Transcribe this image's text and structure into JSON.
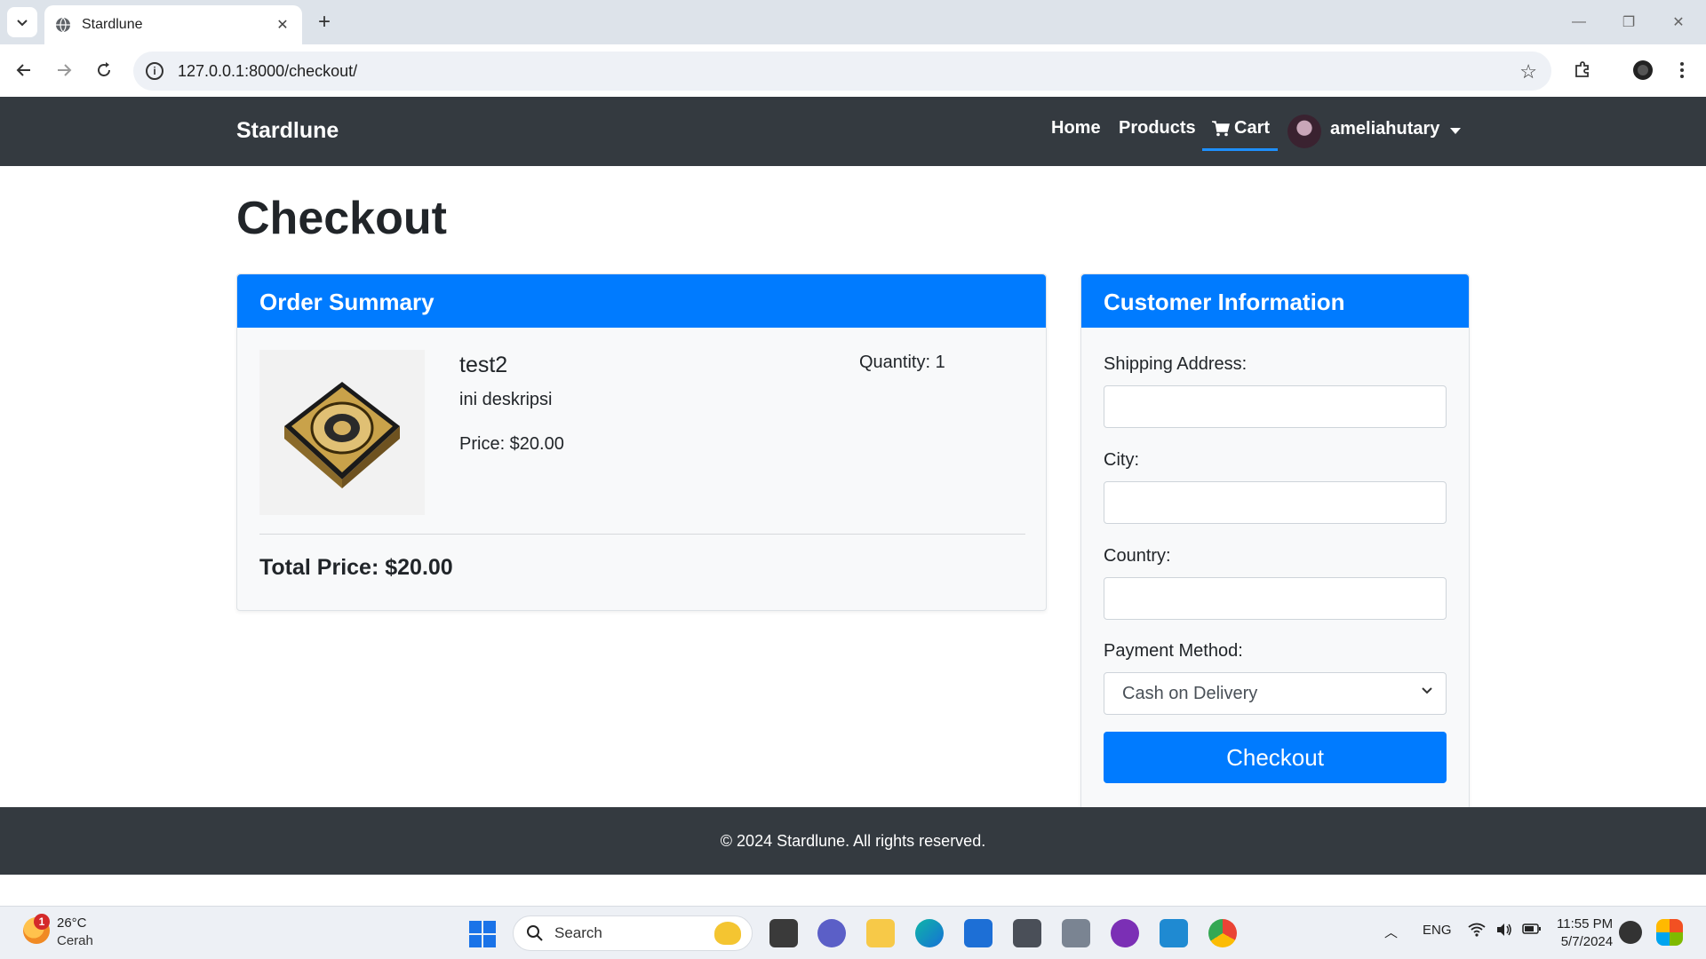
{
  "browser": {
    "tab_title": "Stardlune",
    "url": "127.0.0.1:8000/checkout/"
  },
  "navbar": {
    "brand": "Stardlune",
    "links": [
      "Home",
      "Products",
      "Cart"
    ],
    "username": "ameliahutary"
  },
  "page": {
    "title": "Checkout"
  },
  "order_summary": {
    "header": "Order Summary",
    "item": {
      "name": "test2",
      "description": "ini deskripsi",
      "price": "Price: $20.00",
      "quantity": "Quantity: 1"
    },
    "total": "Total Price: $20.00"
  },
  "customer_info": {
    "header": "Customer Information",
    "shipping_label": "Shipping Address:",
    "shipping_value": "",
    "city_label": "City:",
    "city_value": "",
    "country_label": "Country:",
    "country_value": "",
    "payment_label": "Payment Method:",
    "payment_selected": "Cash on Delivery",
    "submit_label": "Checkout"
  },
  "footer": {
    "text": "© 2024 Stardlune. All rights reserved."
  },
  "taskbar": {
    "weather_temp": "26°C",
    "weather_desc": "Cerah",
    "weather_badge": "1",
    "search_label": "Search",
    "language": "ENG",
    "time": "11:55 PM",
    "date": "5/7/2024"
  },
  "colors": {
    "primary": "#007bff",
    "navbar_bg": "#343a40",
    "card_bg": "#f8f9fa",
    "cart_underline": "#1e90ff"
  }
}
